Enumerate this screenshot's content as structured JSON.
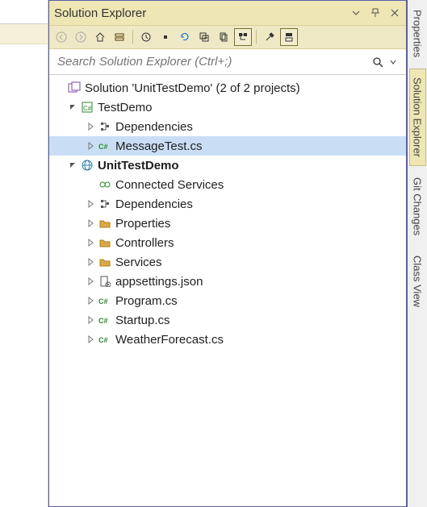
{
  "title": "Solution Explorer",
  "search": {
    "placeholder": "Search Solution Explorer (Ctrl+;)"
  },
  "tree": {
    "solution": "Solution 'UnitTestDemo' (2 of 2 projects)",
    "proj1": "TestDemo",
    "proj1_dep": "Dependencies",
    "proj1_file": "MessageTest.cs",
    "proj2": "UnitTestDemo",
    "proj2_conn": "Connected Services",
    "proj2_dep": "Dependencies",
    "proj2_props": "Properties",
    "proj2_ctrl": "Controllers",
    "proj2_svc": "Services",
    "proj2_app": "appsettings.json",
    "proj2_prog": "Program.cs",
    "proj2_start": "Startup.cs",
    "proj2_wf": "WeatherForecast.cs"
  },
  "tabs": {
    "t1": "Properties",
    "t2": "Solution Explorer",
    "t3": "Git Changes",
    "t4": "Class View"
  }
}
